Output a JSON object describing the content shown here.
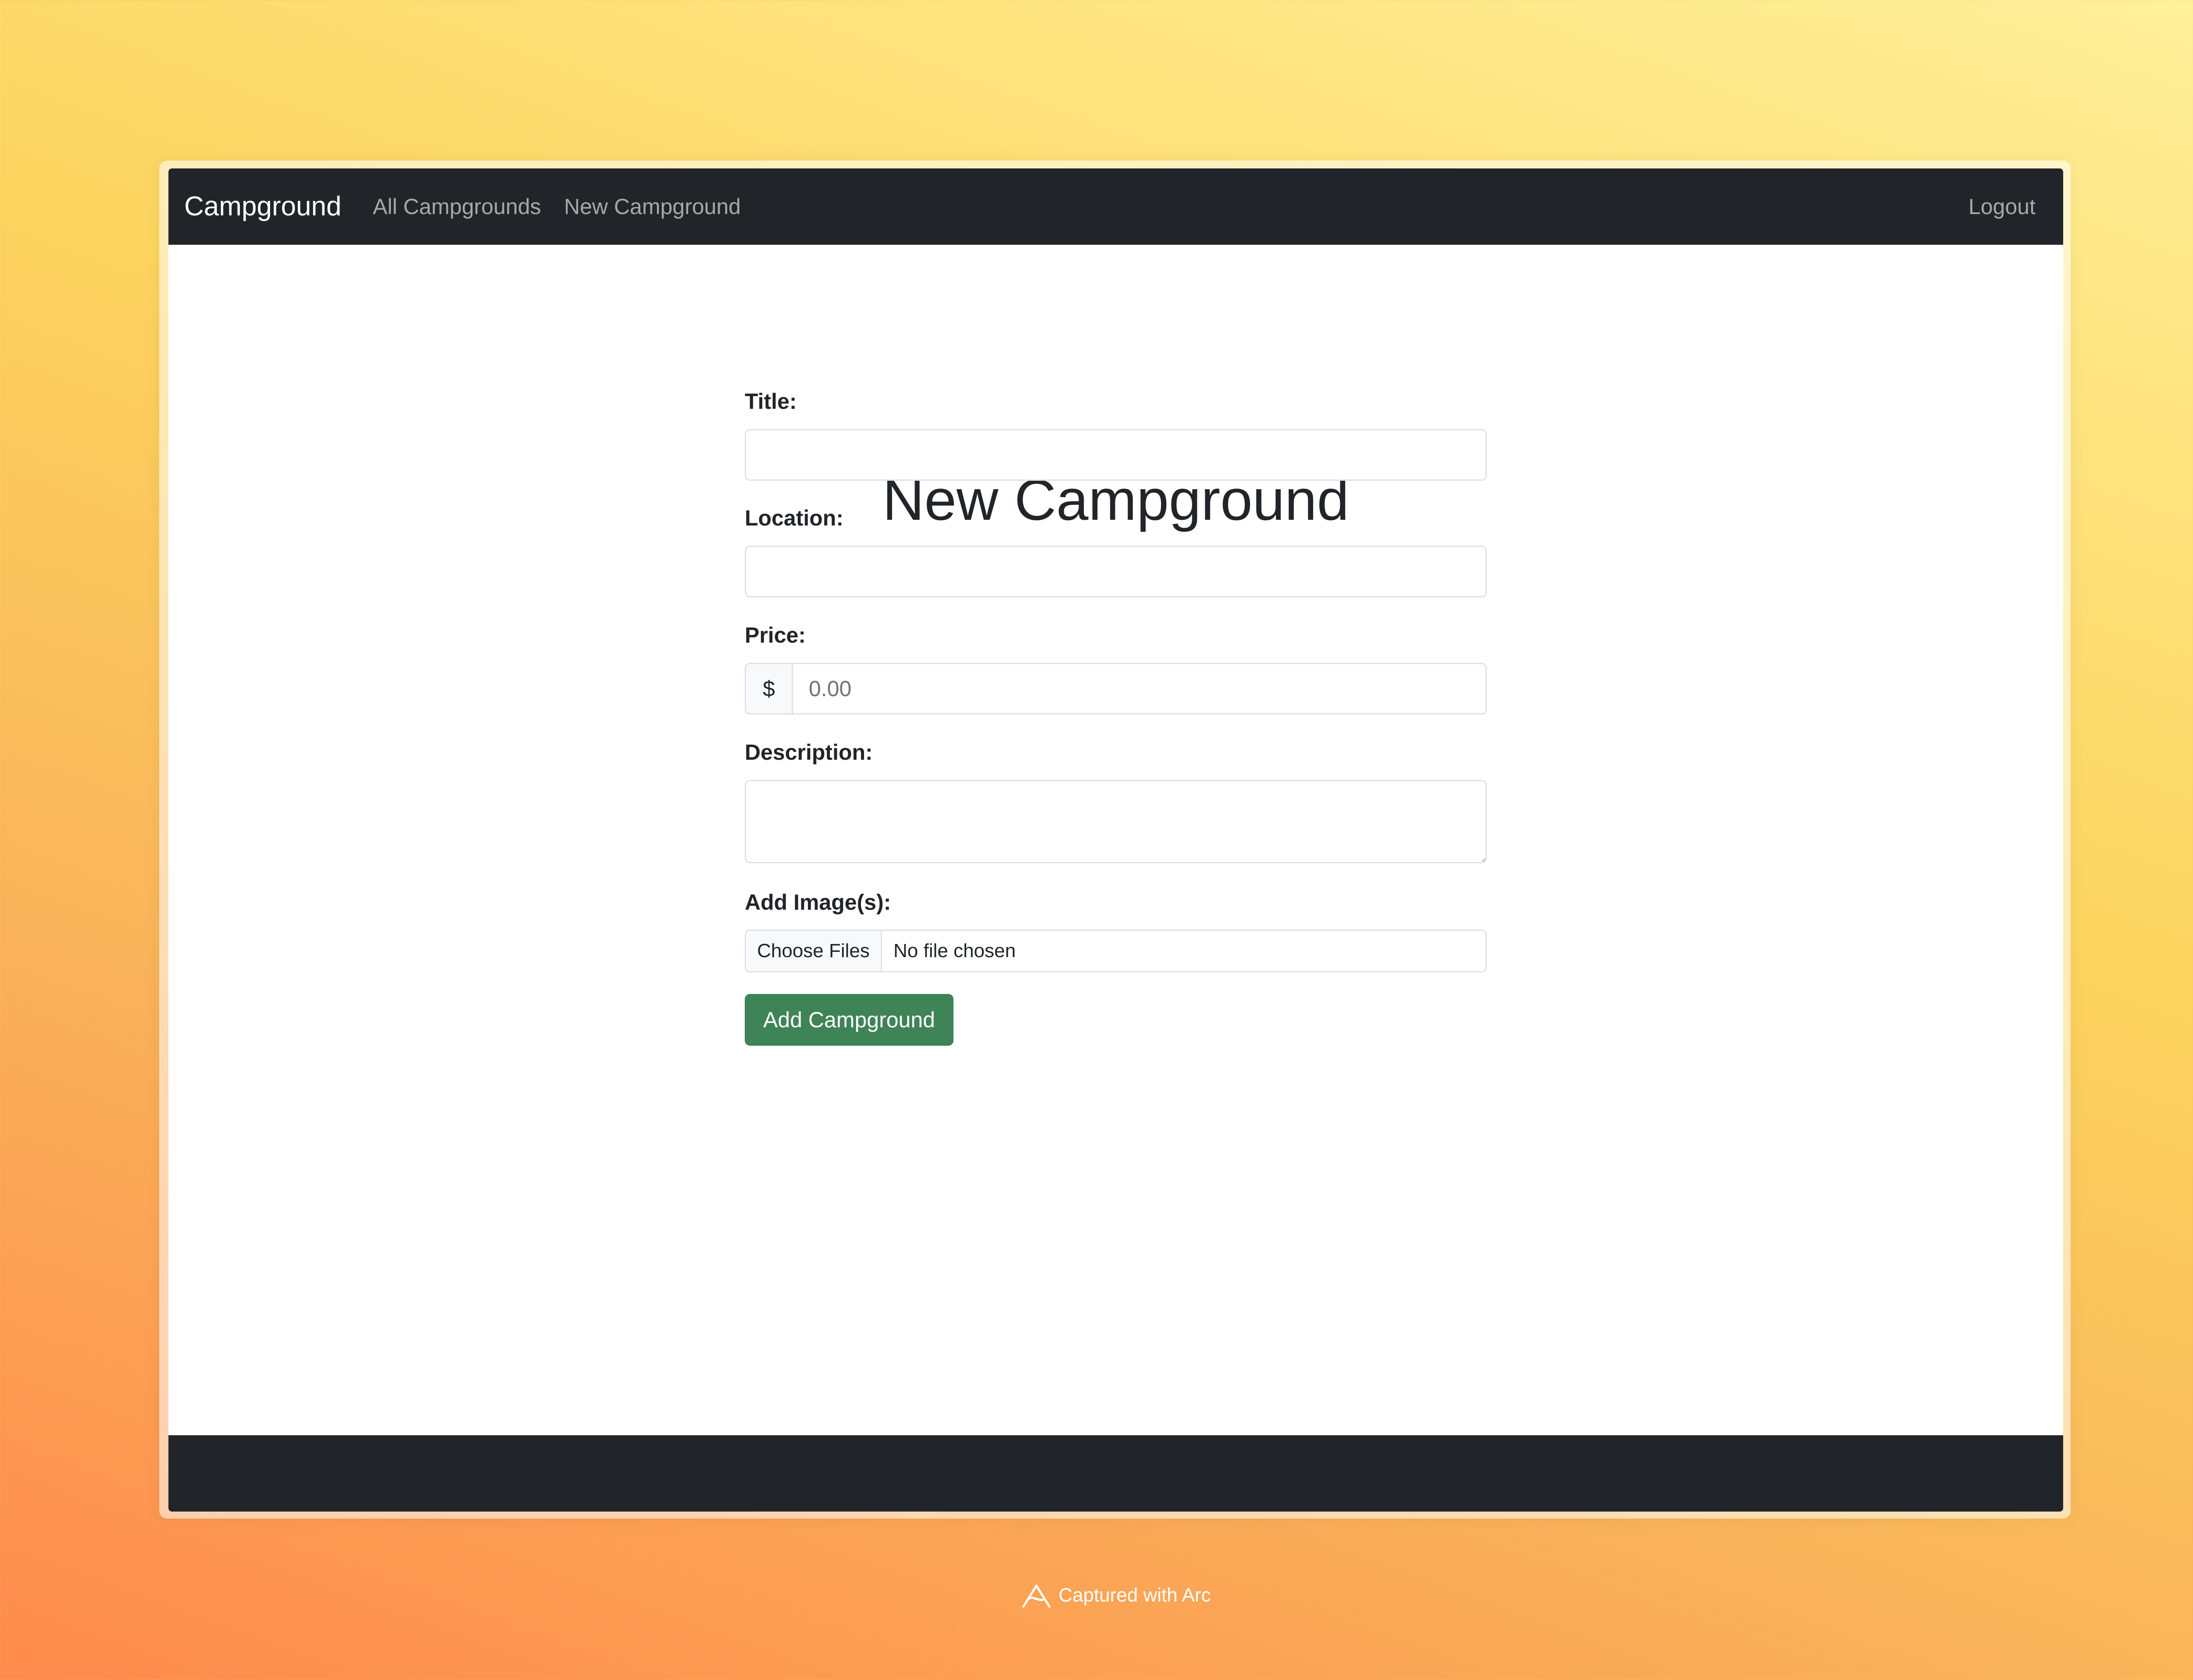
{
  "navbar": {
    "brand": "Campground",
    "links": [
      "All Campgrounds",
      "New Campground"
    ],
    "logout": "Logout"
  },
  "page": {
    "title": "New Campground"
  },
  "form": {
    "title_label": "Title:",
    "title_value": "",
    "location_label": "Location:",
    "location_value": "",
    "price_label": "Price:",
    "price_prefix": "$",
    "price_placeholder": "0.00",
    "description_label": "Description:",
    "description_value": "",
    "images_label": "Add Image(s):",
    "choose_files": "Choose Files",
    "file_status": "No file chosen",
    "submit": "Add Campground"
  },
  "caption": {
    "text": "Captured with Arc",
    "icon": "arc-logo-icon"
  },
  "colors": {
    "navbar": "#212529",
    "submit_button": "#3e8456",
    "background_warm": "#f9b25a"
  }
}
